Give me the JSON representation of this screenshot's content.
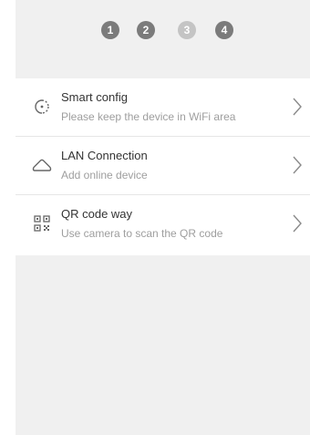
{
  "steps": {
    "items": [
      {
        "label": "1",
        "color": "#7b7b7b"
      },
      {
        "label": "2",
        "color": "#7b7b7b"
      },
      {
        "label": "3",
        "color": "#c4c4c4"
      },
      {
        "label": "4",
        "color": "#7b7b7b"
      }
    ]
  },
  "options": {
    "items": [
      {
        "title": "Smart config",
        "subtitle": "Please keep the device in WiFi area",
        "icon": "smart-config-icon"
      },
      {
        "title": "LAN Connection",
        "subtitle": "Add online device",
        "icon": "cloud-icon"
      },
      {
        "title": "QR code way",
        "subtitle": "Use camera to scan the QR code",
        "icon": "qr-code-icon"
      }
    ]
  },
  "colors": {
    "background": "#f0f0f0",
    "panel": "#ffffff",
    "step_active": "#7b7b7b",
    "step_inactive": "#c4c4c4",
    "title_text": "#333333",
    "subtitle_text": "#9e9e9e",
    "divider": "#e6e6e6"
  }
}
